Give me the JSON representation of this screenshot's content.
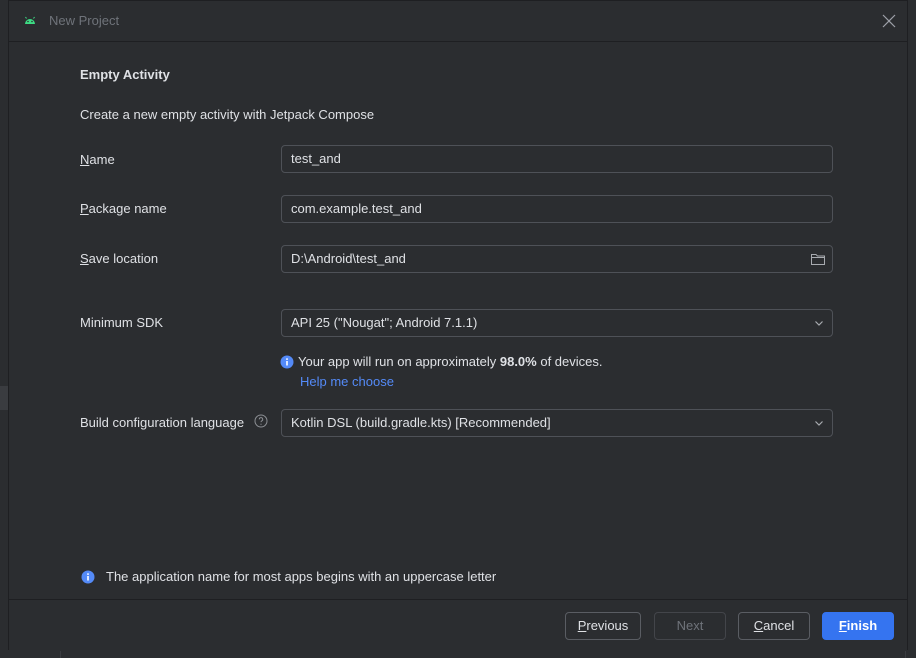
{
  "window": {
    "title": "New Project",
    "app_icon": "android-icon",
    "close_icon": "close-icon"
  },
  "page": {
    "heading": "Empty Activity",
    "description": "Create a new empty activity with Jetpack Compose"
  },
  "form": {
    "name": {
      "label_first": "N",
      "label_rest": "ame",
      "value": "test_and"
    },
    "package": {
      "label_first": "P",
      "label_rest": "ackage name",
      "value": "com.example.test_and"
    },
    "save_location": {
      "label_first": "S",
      "label_rest": "ave location",
      "value": "D:\\Android\\test_and",
      "icon": "folder-icon"
    },
    "min_sdk": {
      "label": "Minimum SDK",
      "value": "API 25 (\"Nougat\"; Android 7.1.1)"
    },
    "sdk_info": {
      "before": "Your app will run on approximately ",
      "percent": "98.0%",
      "after": " of devices."
    },
    "help_link": "Help me choose",
    "build_lang": {
      "label": "Build configuration language",
      "value": "Kotlin DSL (build.gradle.kts) [Recommended]"
    }
  },
  "bottom_info": "The application name for most apps begins with an uppercase letter",
  "footer": {
    "previous": {
      "first": "P",
      "rest": "revious"
    },
    "next": "Next",
    "cancel": {
      "first": "C",
      "rest": "ancel"
    },
    "finish": {
      "first": "F",
      "rest": "inish"
    }
  },
  "colors": {
    "background": "#2b2d30",
    "accent": "#3574f0",
    "link": "#548af7",
    "info": "#548af7"
  }
}
